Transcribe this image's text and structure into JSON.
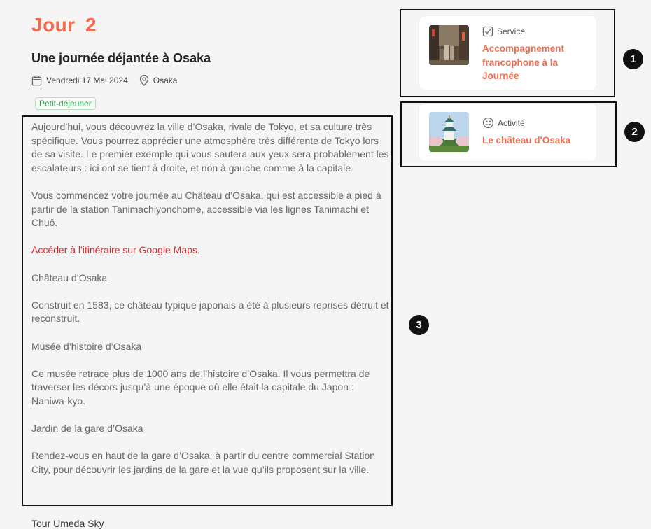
{
  "day": {
    "title": "Jour  2",
    "subtitle": "Une journée déjantée à Osaka"
  },
  "meta": {
    "date": "Vendredi 17 Mai 2024",
    "location": "Osaka"
  },
  "tag": "Petit-déjeuner",
  "cards": [
    {
      "kind": "Service",
      "title": "Accompagnement francophone à la Journée",
      "kind_icon": "checkbox-icon"
    },
    {
      "kind": "Activité",
      "title": "Le château d'Osaka",
      "kind_icon": "smiley-icon"
    }
  ],
  "badges": [
    "1",
    "2",
    "3"
  ],
  "description": {
    "p1": "Aujourd’hui, vous découvrez la ville d’Osaka, rivale de Tokyo, et sa culture très spécifique. Vous pourrez apprécier une atmosphère très différente de Tokyo lors de sa visite. Le premier exemple qui vous sautera aux yeux sera probablement les escalateurs : ici ont se tient à droite, et non à gauche comme à la capitale.",
    "p2": "Vous commencez votre journée au Château d’Osaka, qui est accessible à pied à partir de la station Tanimachiyonchome, accessible via les lignes Tanimachi et Chuô.",
    "link": "Accéder à l'itinéraire sur Google Maps.",
    "h1": "Château d’Osaka",
    "p3": "Construit en 1583, ce château typique japonais a été à plusieurs reprises détruit et reconstruit.",
    "h2": "Musée d’histoire d’Osaka",
    "p4": "Ce musée retrace plus de 1000 ans de l’histoire d’Osaka. Il vous permettra de traverser les décors jusqu’à une époque où elle était la capitale du Japon : Naniwa-kyo.",
    "h3": "Jardin de la gare d’Osaka",
    "p5": "Rendez-vous en haut de la gare d’Osaka, à partir du centre commercial Station City, pour découvrir les jardins de la gare et la vue qu’ils proposent sur la ville.",
    "cutoff": "Tour Umeda Sky"
  }
}
